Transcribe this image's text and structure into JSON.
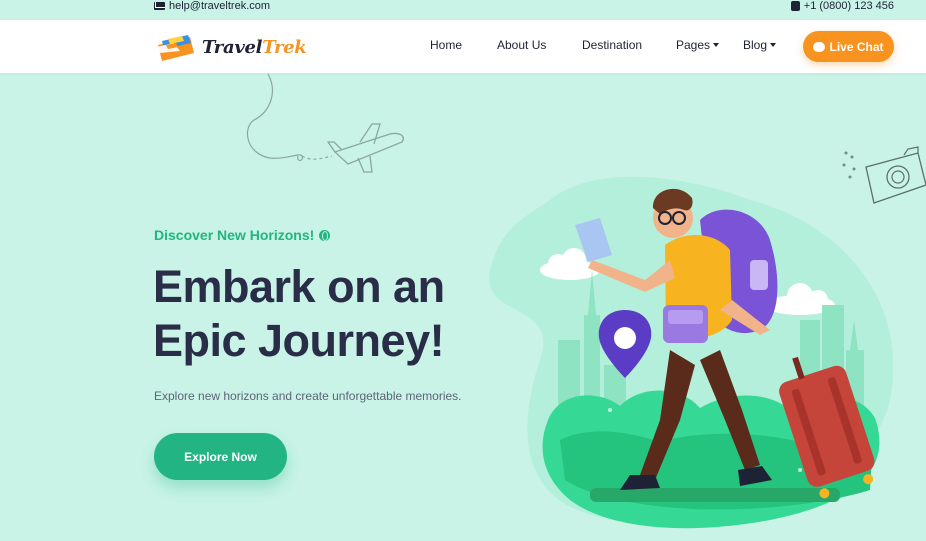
{
  "topbar": {
    "email": "help@traveltrek.com",
    "phone": "+1 (0800) 123 456",
    "email_icon": "mail-icon",
    "phone_icon": "phone-icon"
  },
  "brand": {
    "name_part1": "Travel",
    "name_part2": "Trek"
  },
  "nav": {
    "items": [
      {
        "label": "Home"
      },
      {
        "label": "About Us"
      },
      {
        "label": "Destination"
      },
      {
        "label": "Pages"
      },
      {
        "label": "Blog"
      }
    ],
    "cta": "Live Chat",
    "cta_icon": "chat-icon"
  },
  "hero": {
    "tagline": "Discover New Horizons!",
    "tagline_icon": "globe-icon",
    "title_line1": "Embark on an",
    "title_line2": "Epic Journey!",
    "subtitle": "Explore new horizons and create unforgettable memories.",
    "button": "Explore Now"
  },
  "colors": {
    "background": "#c8f3e6",
    "accent_green": "#22b583",
    "accent_orange": "#f7931e",
    "text_dark": "#2a2d47"
  }
}
